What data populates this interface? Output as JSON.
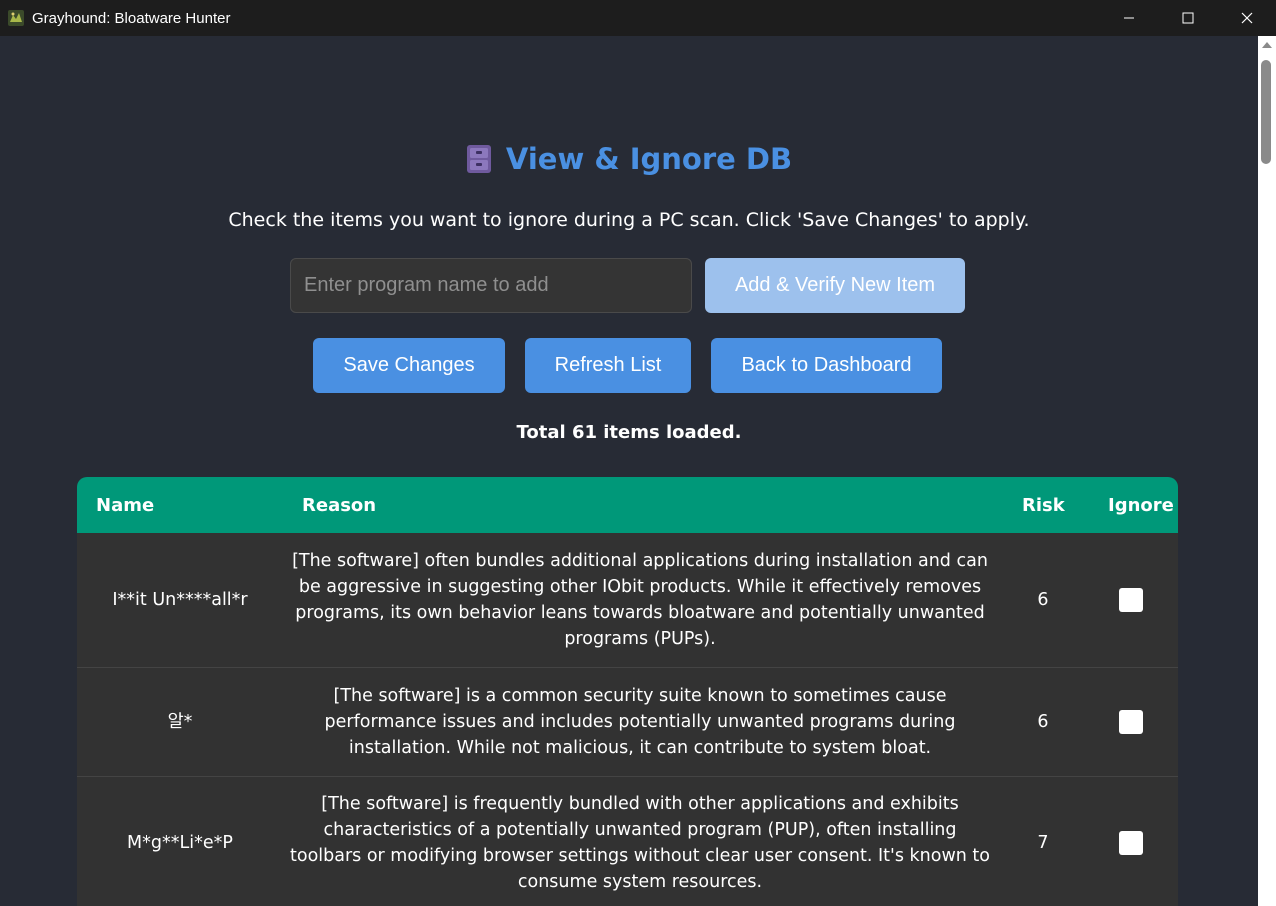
{
  "window": {
    "title": "Grayhound: Bloatware Hunter",
    "controls": [
      "minimize-icon",
      "maximize-icon",
      "close-icon"
    ]
  },
  "page": {
    "icon": "file-cabinet-icon",
    "title": "View & Ignore DB",
    "instructions": "Check the items you want to ignore during a PC scan. Click 'Save Changes' to apply."
  },
  "add_item": {
    "placeholder": "Enter program name to add",
    "value": "",
    "button_label": "Add & Verify New Item"
  },
  "actions": {
    "save_label": "Save Changes",
    "refresh_label": "Refresh List",
    "back_label": "Back to Dashboard"
  },
  "status": {
    "total_text": "Total 61 items loaded."
  },
  "table": {
    "headers": {
      "name": "Name",
      "reason": "Reason",
      "risk": "Risk",
      "ignore": "Ignore"
    },
    "rows": [
      {
        "name": "I**it Un****all*r",
        "reason": "[The software] often bundles additional applications during installation and can be aggressive in suggesting other IObit products. While it effectively removes programs, its own behavior leans towards bloatware and potentially unwanted programs (PUPs).",
        "risk": "6",
        "ignored": false
      },
      {
        "name": "알*",
        "reason": "[The software] is a common security suite known to sometimes cause performance issues and includes potentially unwanted programs during installation. While not malicious, it can contribute to system bloat.",
        "risk": "6",
        "ignored": false
      },
      {
        "name": "M*g**Li*e*P",
        "reason": "[The software] is frequently bundled with other applications and exhibits characteristics of a potentially unwanted program (PUP), often installing toolbars or modifying browser settings without clear user consent. It's known to consume system resources.",
        "risk": "7",
        "ignored": false
      }
    ]
  },
  "colors": {
    "background": "#272b35",
    "accent": "#4a90e2",
    "table_header": "#009879",
    "row": "#323232"
  }
}
